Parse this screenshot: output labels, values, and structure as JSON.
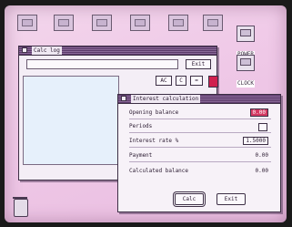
{
  "desktop": {
    "icons": [
      {
        "label": "POWER"
      },
      {
        "label": "CLOCK"
      }
    ]
  },
  "back_window": {
    "title": "Calc log",
    "exit_label": "Exit",
    "buttons": [
      "AC",
      "C",
      "="
    ]
  },
  "dialog": {
    "title": "Interest calculation",
    "rows": [
      {
        "label": "Opening balance",
        "value": "0.00"
      },
      {
        "label": "Periods",
        "value": ""
      },
      {
        "label": "Interest rate %",
        "value": "1.5000"
      },
      {
        "label": "Payment",
        "value": "0.00"
      },
      {
        "label": "Calculated balance",
        "value": "0.00"
      }
    ],
    "calc_label": "Calc",
    "exit_label": "Exit"
  },
  "colors": {
    "desktop": "#efc8e7",
    "accent_red": "#d43a62",
    "titlebar": "#5b3a6a"
  }
}
